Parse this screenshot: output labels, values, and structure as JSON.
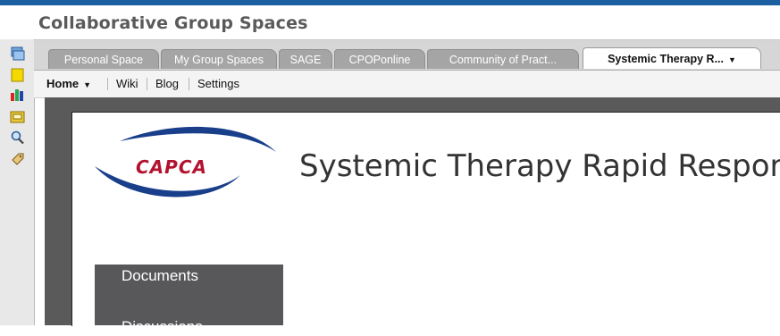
{
  "app": {
    "title": "Collaborative Group Spaces"
  },
  "tabs": [
    {
      "label": "Personal Space"
    },
    {
      "label": "My Group Spaces"
    },
    {
      "label": "SAGE"
    },
    {
      "label": "CPOPonline"
    },
    {
      "label": "Community of Pract..."
    },
    {
      "label": "Systemic Therapy R...",
      "active": true
    }
  ],
  "subnav": {
    "home": "Home",
    "wiki": "Wiki",
    "blog": "Blog",
    "settings": "Settings"
  },
  "logo": {
    "text": "CAPCA"
  },
  "page": {
    "heading": "Systemic Therapy Rapid Respor"
  },
  "side_menu": {
    "items": [
      {
        "label": "Documents"
      },
      {
        "label": "Discussions"
      }
    ]
  },
  "rail": {
    "icons": [
      "window-icon",
      "sticky-note-icon",
      "chart-icon",
      "folder-icon",
      "search-icon",
      "tag-icon"
    ]
  },
  "colors": {
    "tab_inactive": "#a5a5a5",
    "tab_active": "#ffffff",
    "frame": "#5a5a5a",
    "logo_red": "#b3122f",
    "logo_blue": "#1a3f8a"
  }
}
